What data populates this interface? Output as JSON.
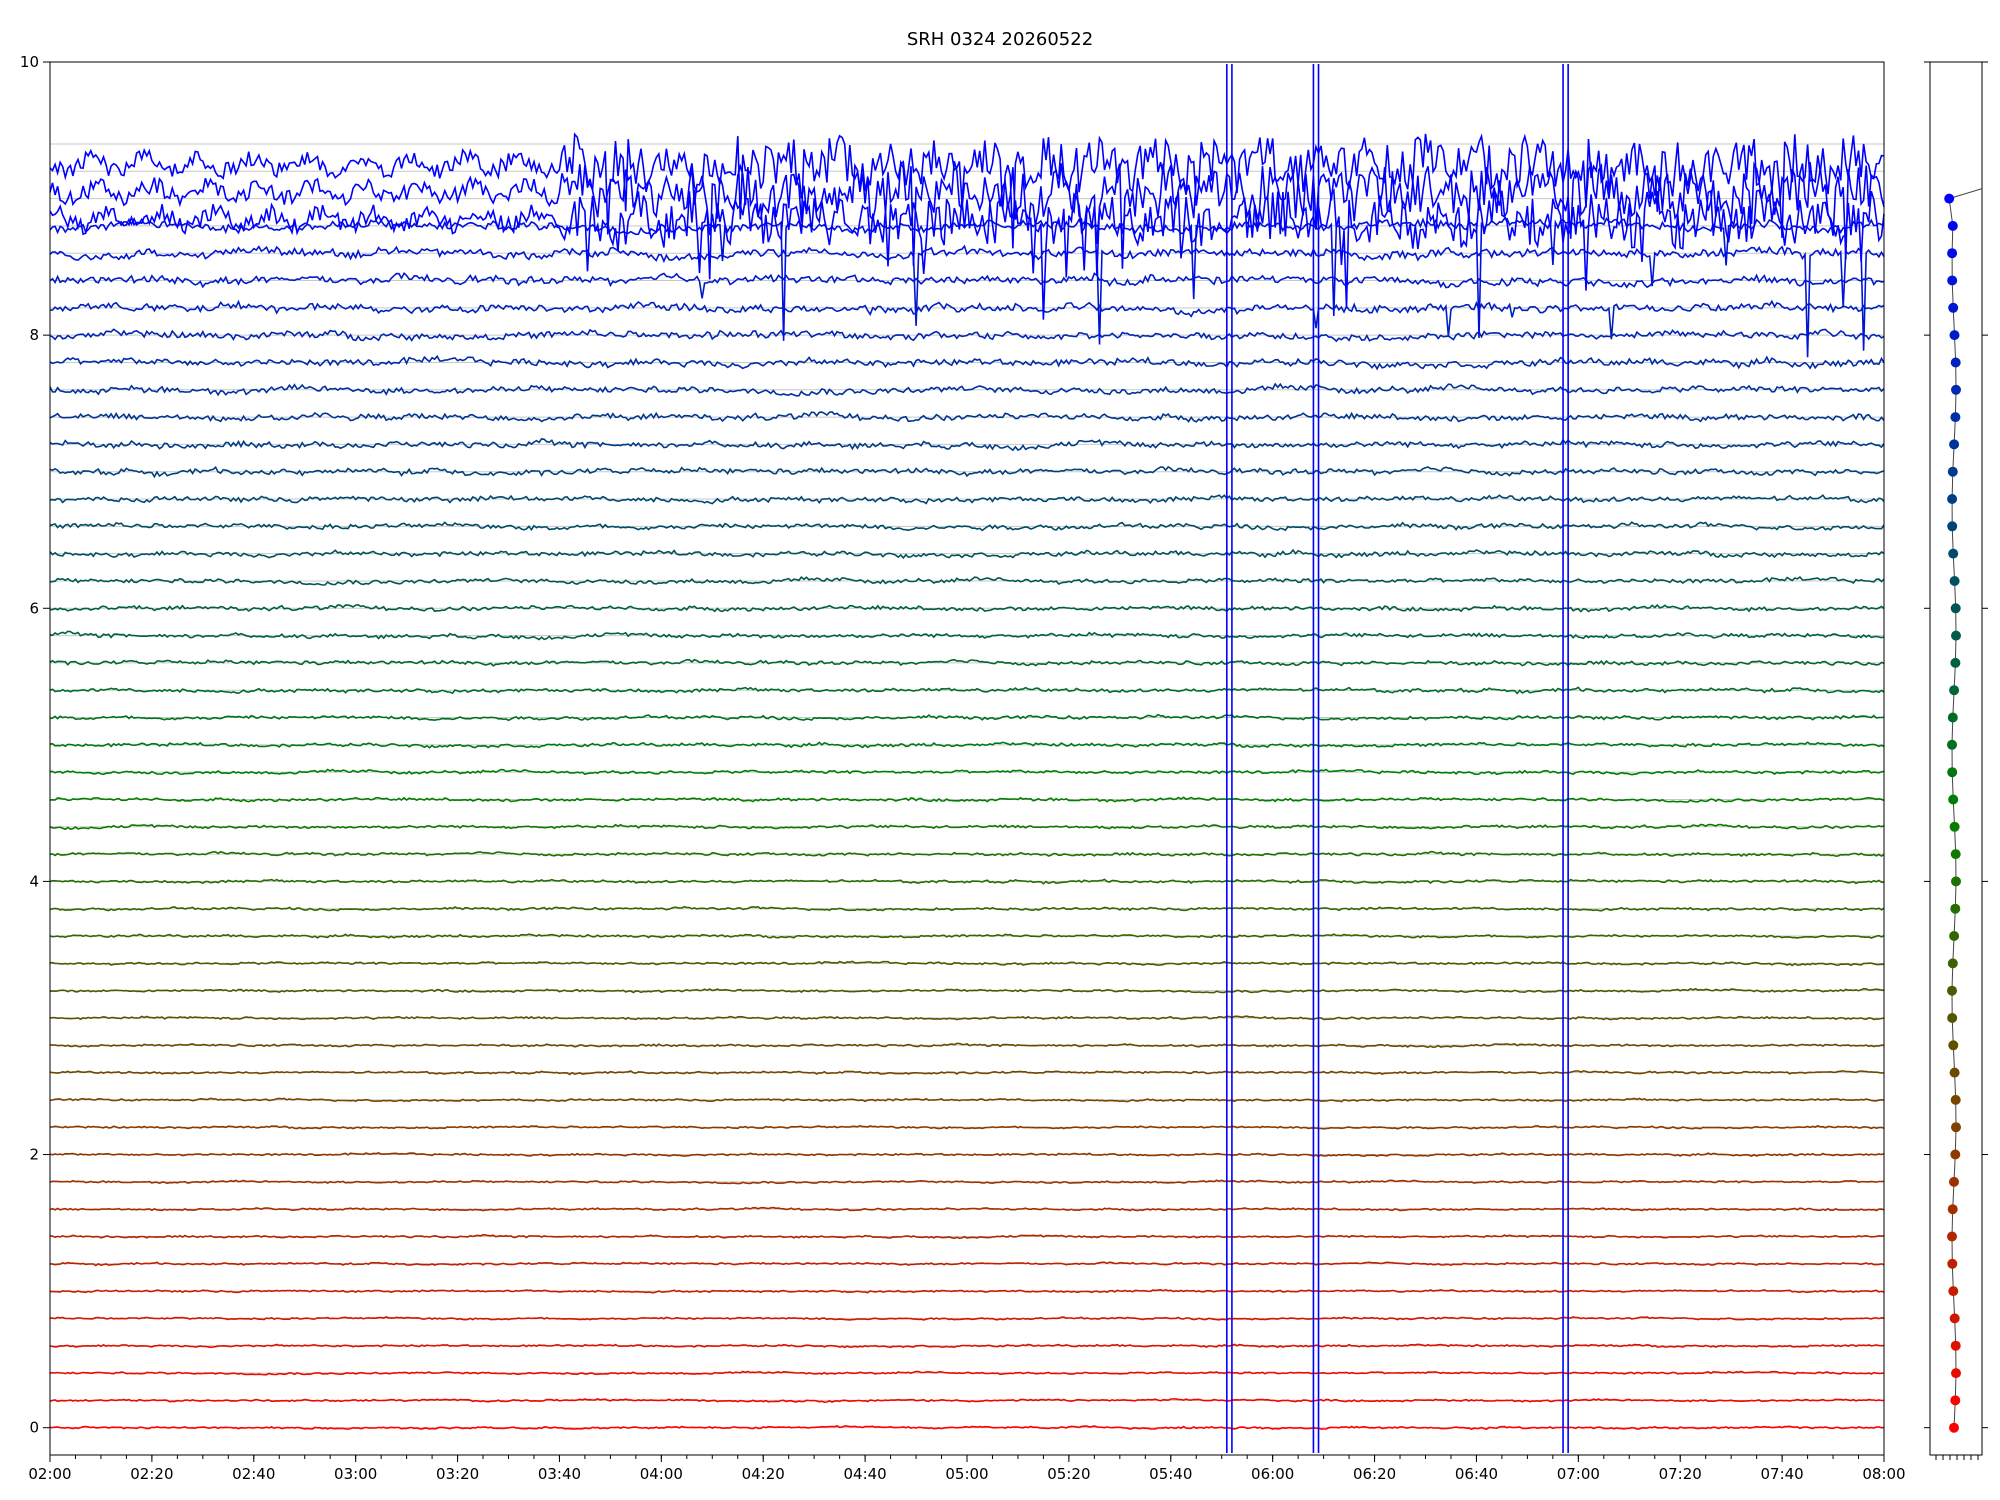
{
  "chart_data": {
    "type": "line",
    "title": "SRH 0324 20260522",
    "xlabel": "",
    "ylabel": "",
    "xlim": [
      "02:00",
      "08:00"
    ],
    "ylim": [
      -0.2,
      10
    ],
    "x_ticks": [
      "02:00",
      "02:20",
      "02:40",
      "03:00",
      "03:20",
      "03:40",
      "04:00",
      "04:20",
      "04:40",
      "05:00",
      "05:20",
      "05:40",
      "06:00",
      "06:20",
      "06:40",
      "07:00",
      "07:20",
      "07:40",
      "08:00"
    ],
    "y_ticks": [
      0,
      2,
      4,
      6,
      8,
      10
    ],
    "grid": true,
    "series_count": 48,
    "trace_baselines": [
      0.0,
      0.2,
      0.4,
      0.6,
      0.8,
      1.0,
      1.2,
      1.4,
      1.6,
      1.8,
      2.0,
      2.2,
      2.4,
      2.6,
      2.8,
      3.0,
      3.2,
      3.4,
      3.6,
      3.8,
      4.0,
      4.2,
      4.4,
      4.6,
      4.8,
      5.0,
      5.2,
      5.4,
      5.6,
      5.8,
      6.0,
      6.2,
      6.4,
      6.6,
      6.8,
      7.0,
      7.2,
      7.4,
      7.6,
      7.8,
      8.0,
      8.2,
      8.4,
      8.6,
      8.8,
      9.0,
      9.2,
      9.4
    ],
    "color_scale": [
      "#ff0000",
      "#008000",
      "#0000ff"
    ],
    "spike_color": "#0000ff",
    "spike_times": [
      "05:51",
      "05:52",
      "06:08",
      "06:09",
      "06:57",
      "06:58"
    ],
    "side_panel": {
      "points": 46,
      "ylim": [
        -0.2,
        10
      ],
      "y_ticks": [
        0,
        2,
        4,
        6,
        8,
        10
      ]
    }
  }
}
